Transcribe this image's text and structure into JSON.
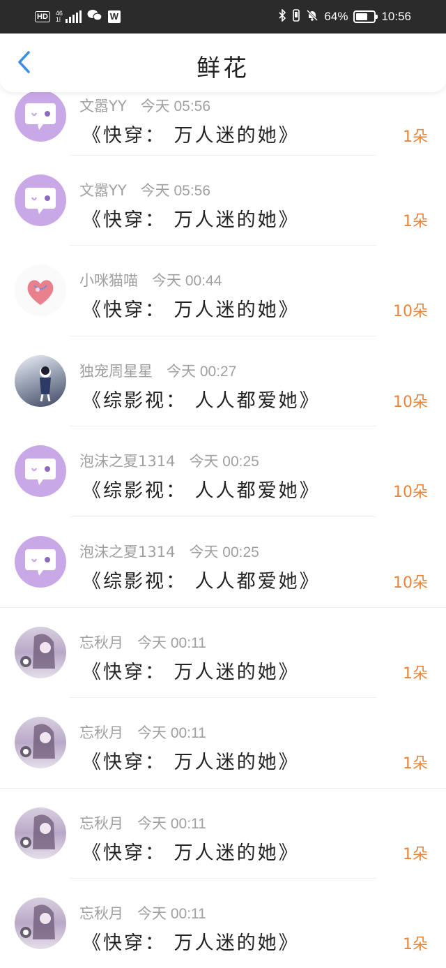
{
  "status_bar": {
    "hd": "HD",
    "network": "46",
    "network_sub": "1l",
    "w_icon": "W",
    "battery": "64%",
    "time": "10:56"
  },
  "header": {
    "title": "鲜花",
    "back_icon": "chevron-left-icon"
  },
  "rows": [
    {
      "user": "文嚣YY",
      "time": "今天 05:56",
      "book": "《快穿：  万人迷的她》",
      "count": "1朵",
      "avatar": "default"
    },
    {
      "user": "文嚣YY",
      "time": "今天 05:56",
      "book": "《快穿：  万人迷的她》",
      "count": "1朵",
      "avatar": "default"
    },
    {
      "user": "小咪猫喵",
      "time": "今天 00:44",
      "book": "《快穿：  万人迷的她》",
      "count": "10朵",
      "avatar": "heart"
    },
    {
      "user": "独宠周星星",
      "time": "今天 00:27",
      "book": "《综影视：  人人都爱她》",
      "count": "10朵",
      "avatar": "anime"
    },
    {
      "user": "泡沫之夏1314",
      "time": "今天 00:25",
      "book": "《综影视：  人人都爱她》",
      "count": "10朵",
      "avatar": "default"
    },
    {
      "user": "泡沫之夏1314",
      "time": "今天 00:25",
      "book": "《综影视：  人人都爱她》",
      "count": "10朵",
      "avatar": "default"
    },
    {
      "user": "忘秋月",
      "time": "今天 00:11",
      "book": "《快穿：  万人迷的她》",
      "count": "1朵",
      "avatar": "girl"
    },
    {
      "user": "忘秋月",
      "time": "今天 00:11",
      "book": "《快穿：  万人迷的她》",
      "count": "1朵",
      "avatar": "girl"
    },
    {
      "user": "忘秋月",
      "time": "今天 00:11",
      "book": "《快穿：  万人迷的她》",
      "count": "1朵",
      "avatar": "girl"
    },
    {
      "user": "忘秋月",
      "time": "今天 00:11",
      "book": "《快穿：  万人迷的她》",
      "count": "1朵",
      "avatar": "girl"
    }
  ],
  "colors": {
    "status_bar_bg": "#2b2b2b",
    "back_arrow": "#3a8ee6",
    "count": "#e8853a",
    "avatar_default": "#c9a8e8"
  }
}
